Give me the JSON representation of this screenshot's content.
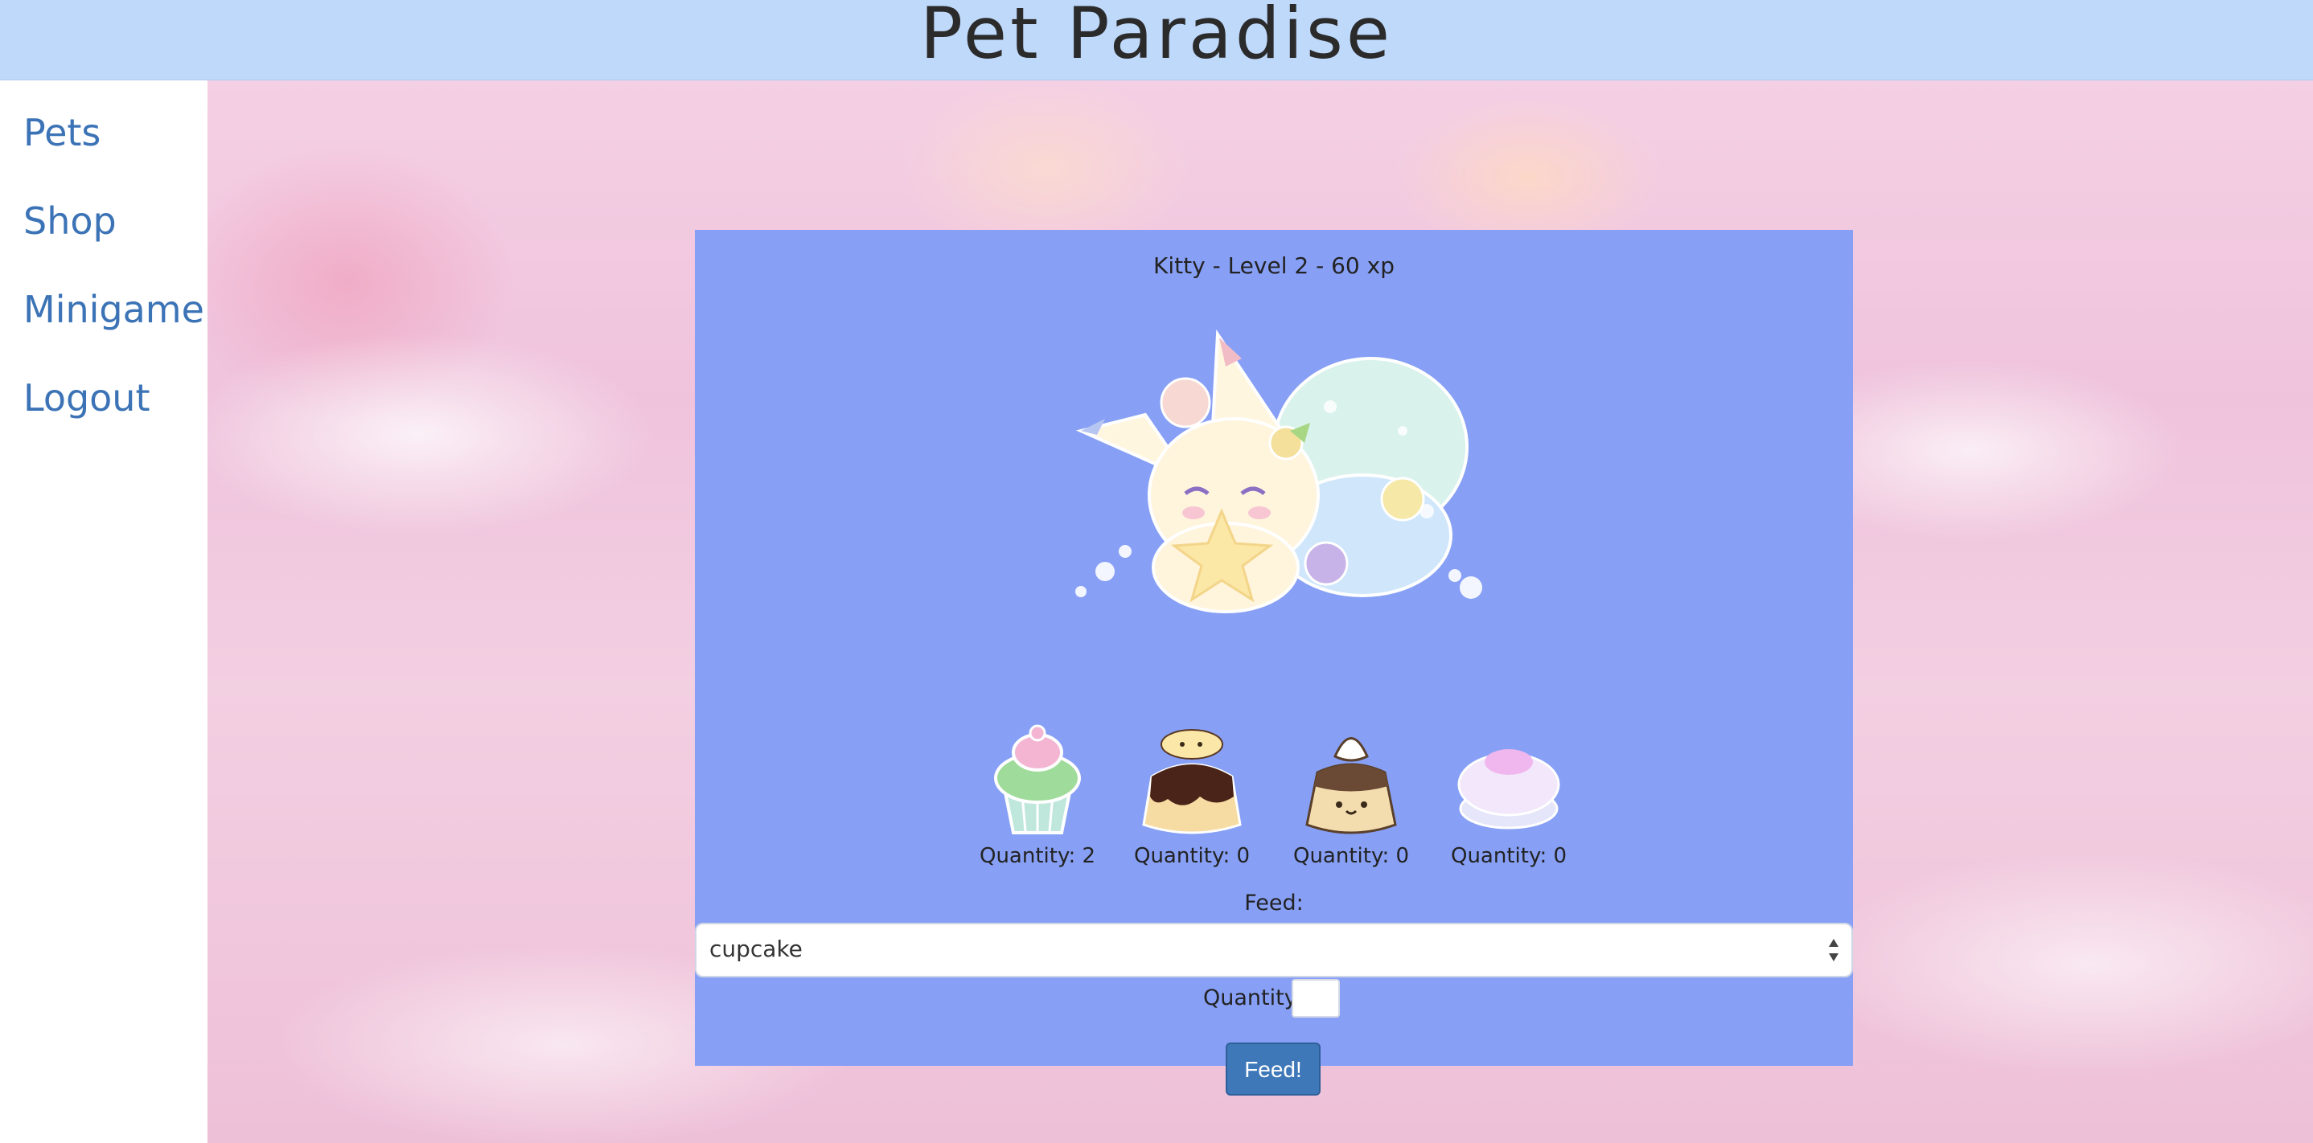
{
  "header": {
    "title": "Pet Paradise"
  },
  "sidebar": {
    "items": [
      {
        "label": "Pets"
      },
      {
        "label": "Shop"
      },
      {
        "label": "Minigame"
      },
      {
        "label": "Logout"
      }
    ]
  },
  "pet": {
    "caption": "Kitty - Level 2 - 60 xp"
  },
  "inventory": [
    {
      "food": "cupcake",
      "quantity_label": "Quantity: 2"
    },
    {
      "food": "pudding",
      "quantity_label": "Quantity: 0"
    },
    {
      "food": "chocolate-pudding",
      "quantity_label": "Quantity: 0"
    },
    {
      "food": "macaron",
      "quantity_label": "Quantity: 0"
    }
  ],
  "feed_form": {
    "label": "Feed:",
    "selected_food": "cupcake",
    "quantity_label": "Quantity:",
    "quantity_value": "",
    "submit_label": "Feed!"
  },
  "colors": {
    "header_bg": "#bfd9fb",
    "panel_bg": "#87a0f5",
    "link": "#3b73b6",
    "button": "#3f78b8"
  },
  "icons": [
    "cat-pet-icon",
    "cupcake-icon",
    "pudding-icon",
    "chocolate-pudding-icon",
    "macaron-icon",
    "select-arrows-icon"
  ]
}
